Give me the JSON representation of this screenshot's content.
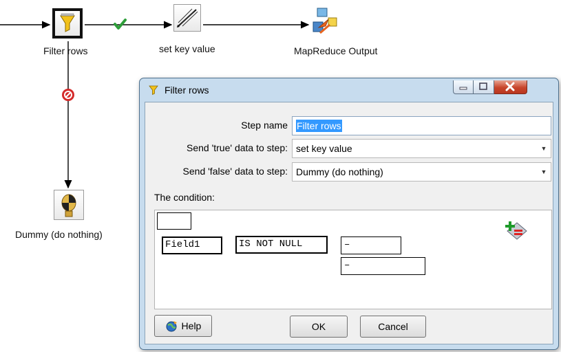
{
  "steps": {
    "filter_rows": "Filter rows",
    "set_key_value": "set key value",
    "mapreduce_output": "MapReduce Output",
    "dummy": "Dummy (do nothing)"
  },
  "hops": {
    "true_hop_icon": "checkmark-icon",
    "false_hop_icon": "stop-icon"
  },
  "dialog": {
    "title": "Filter rows",
    "step_name_label": "Step name",
    "step_name_value": "Filter rows",
    "true_step_label": "Send 'true' data to step:",
    "true_step_value": "set key value",
    "false_step_label": "Send 'false' data to step:",
    "false_step_value": "Dummy (do nothing)",
    "condition_label": "The condition:",
    "condition": {
      "field": "Field1",
      "operator": "IS NOT NULL",
      "value1": "–",
      "value2": "–"
    },
    "help_label": "Help",
    "ok_label": "OK",
    "cancel_label": "Cancel"
  },
  "colors": {
    "dialog_frame": "#c7dcee",
    "selection": "#3399ff",
    "close_button": "#c7452b",
    "true_hop": "#2e9e3a",
    "false_hop": "#cc2020"
  }
}
